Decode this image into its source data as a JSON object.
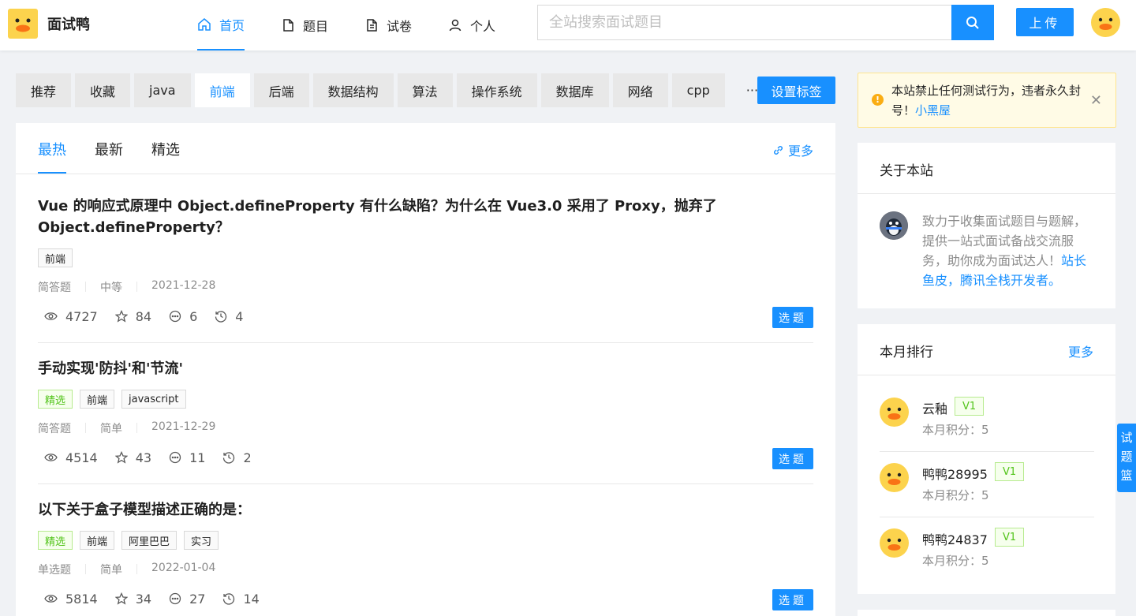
{
  "header": {
    "site_name": "面试鸭",
    "nav": [
      {
        "label": "首页",
        "icon": "home-icon"
      },
      {
        "label": "题目",
        "icon": "file-icon"
      },
      {
        "label": "试卷",
        "icon": "paper-icon"
      },
      {
        "label": "个人",
        "icon": "user-icon"
      }
    ],
    "search_placeholder": "全站搜索面试题目",
    "upload_label": "上传"
  },
  "tagbar": {
    "tags": [
      "推荐",
      "收藏",
      "java",
      "前端",
      "后端",
      "数据结构",
      "算法",
      "操作系统",
      "数据库",
      "网络",
      "cpp"
    ],
    "active": "前端",
    "more": "···",
    "set_tags_label": "设置标签"
  },
  "tabs": {
    "items": [
      "最热",
      "最新",
      "精选"
    ],
    "active": "最热",
    "more_label": "更多"
  },
  "questions": [
    {
      "title": "Vue 的响应式原理中 Object.defineProperty 有什么缺陷？为什么在 Vue3.0 采用了 Proxy，抛弃了 Object.defineProperty？",
      "tags": [
        {
          "label": "前端",
          "featured": false
        }
      ],
      "type": "简答题",
      "difficulty": "中等",
      "date": "2021-12-28",
      "views": "4727",
      "stars": "84",
      "comments": "6",
      "answers": "4",
      "pick_label": "选题"
    },
    {
      "title": "手动实现'防抖'和'节流'",
      "tags": [
        {
          "label": "精选",
          "featured": true
        },
        {
          "label": "前端",
          "featured": false
        },
        {
          "label": "javascript",
          "featured": false
        }
      ],
      "type": "简答题",
      "difficulty": "简单",
      "date": "2021-12-29",
      "views": "4514",
      "stars": "43",
      "comments": "11",
      "answers": "2",
      "pick_label": "选题"
    },
    {
      "title": "以下关于盒子模型描述正确的是：",
      "tags": [
        {
          "label": "精选",
          "featured": true
        },
        {
          "label": "前端",
          "featured": false
        },
        {
          "label": "阿里巴巴",
          "featured": false
        },
        {
          "label": "实习",
          "featured": false
        }
      ],
      "type": "单选题",
      "difficulty": "简单",
      "date": "2022-01-04",
      "views": "5814",
      "stars": "34",
      "comments": "27",
      "answers": "14",
      "pick_label": "选题"
    }
  ],
  "alert": {
    "text": "本站禁止任何测试行为，违者永久封号！",
    "link": "小黑屋"
  },
  "about": {
    "title": "关于本站",
    "text": "致力于收集面试题目与题解，提供一站式面试备战交流服务，助你成为面试达人！",
    "link": "站长鱼皮，腾讯全栈开发者。"
  },
  "ranking": {
    "title": "本月排行",
    "more_label": "更多",
    "items": [
      {
        "name": "云釉",
        "level": "V1",
        "points": "本月积分：5"
      },
      {
        "name": "鸭鸭28995",
        "level": "V1",
        "points": "本月积分：5"
      },
      {
        "name": "鸭鸭24837",
        "level": "V1",
        "points": "本月积分：5"
      }
    ]
  },
  "basket_label": "试题篮",
  "colors": {
    "accent": "#1890ff",
    "featured": "#52c41a",
    "warning": "#faad14"
  }
}
